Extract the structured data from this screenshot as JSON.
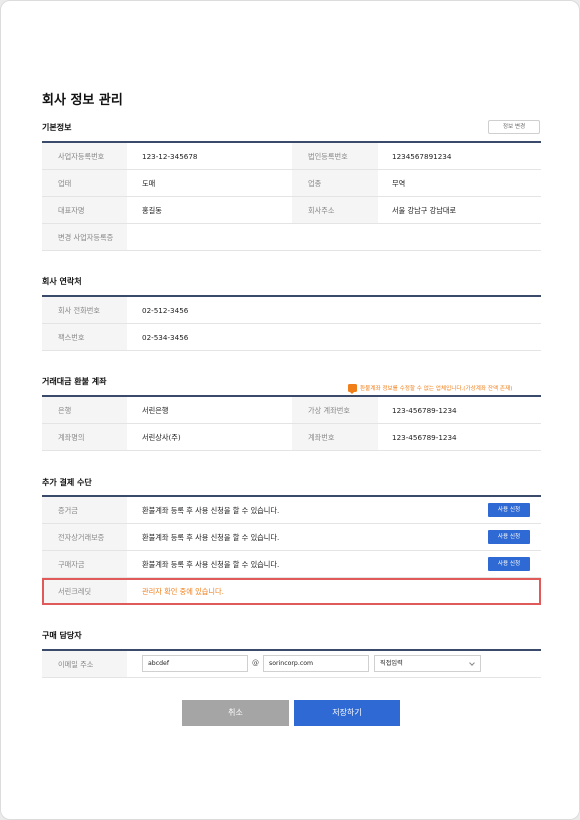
{
  "page_title": "회사 정보 관리",
  "basic": {
    "title": "기본정보",
    "edit_button": "정보 변경",
    "rows": [
      {
        "l1": "사업자등록번호",
        "v1": "123-12-345678",
        "l2": "법인등록번호",
        "v2": "1234567891234"
      },
      {
        "l1": "업태",
        "v1": "도매",
        "l2": "업종",
        "v2": "무역"
      },
      {
        "l1": "대표자명",
        "v1": "홍길동",
        "l2": "회사주소",
        "v2": "서울 강남구 강남대로"
      },
      {
        "l1": "변경 사업자등록증",
        "v1": "",
        "l2": "",
        "v2": ""
      }
    ]
  },
  "contact": {
    "title": "회사 연락처",
    "rows": [
      {
        "label": "회사 전화번호",
        "value": "02-512-3456"
      },
      {
        "label": "팩스번호",
        "value": "02-534-3456"
      }
    ]
  },
  "refund": {
    "title": "거래대금 환불 계좌",
    "notice": "환불계좌 정보를 수정할 수 없는 업체입니다.(가상계좌 잔액 존재)",
    "rows": [
      {
        "l1": "은행",
        "v1": "서린은행",
        "l2": "가상 계좌번호",
        "v2": "123-456789-1234"
      },
      {
        "l1": "계좌명의",
        "v1": "서린상사(주)",
        "l2": "계좌번호",
        "v2": "123-456789-1234"
      }
    ]
  },
  "payment": {
    "title": "추가 결제 수단",
    "rows": [
      {
        "label": "증거금",
        "value": "환불계좌 등록 후 사용 신청을 할 수 있습니다.",
        "button": "사용 신청"
      },
      {
        "label": "전자상거래보증",
        "value": "환불계좌 등록 후 사용 신청을 할 수 있습니다.",
        "button": "사용 신청"
      },
      {
        "label": "구매자금",
        "value": "환불계좌 등록 후 사용 신청을 할 수 있습니다.",
        "button": "사용 신청"
      },
      {
        "label": "서린크레딧",
        "value": "관리자 확인 중에 있습니다."
      }
    ]
  },
  "buyer": {
    "title": "구매 담당자",
    "email_label": "이메일 주소",
    "email_id": "abcdef",
    "at": "@",
    "email_domain": "sorincorp.com",
    "domain_select": "직접입력"
  },
  "actions": {
    "cancel": "취소",
    "save": "저장하기"
  },
  "colors": {
    "accent": "#2f6ad4",
    "warning": "#f07f1a",
    "highlight_border": "#e05a5a",
    "section_line": "#3a4a6a"
  }
}
